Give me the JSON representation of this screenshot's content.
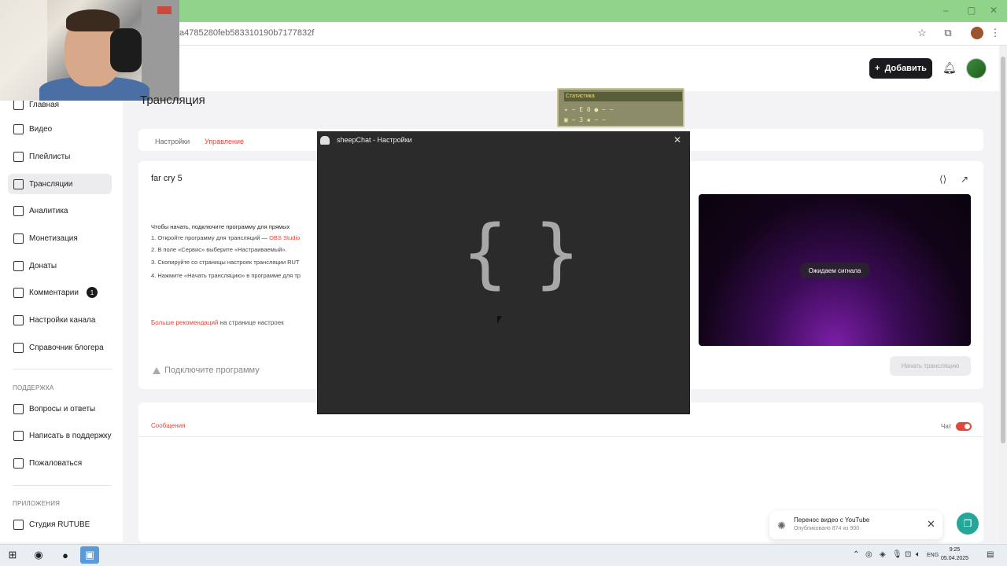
{
  "browser": {
    "url": "a4785280feb583310190b7177832f",
    "window_controls": [
      "–",
      "▢",
      "✕"
    ]
  },
  "header": {
    "add_button_label": "Добавить"
  },
  "sidebar": {
    "items": [
      {
        "label": "Главная",
        "icon": "home-icon"
      },
      {
        "label": "Видео",
        "icon": "video-icon"
      },
      {
        "label": "Плейлисты",
        "icon": "playlist-icon"
      },
      {
        "label": "Трансляции",
        "icon": "broadcast-icon",
        "active": true
      },
      {
        "label": "Аналитика",
        "icon": "analytics-icon"
      },
      {
        "label": "Монетизация",
        "icon": "monetization-icon"
      },
      {
        "label": "Донаты",
        "icon": "donations-icon"
      },
      {
        "label": "Комментарии",
        "icon": "comments-icon",
        "badge": "1"
      },
      {
        "label": "Настройки канала",
        "icon": "settings-icon"
      },
      {
        "label": "Справочник блогера",
        "icon": "handbook-icon"
      }
    ],
    "support_heading": "ПОДДЕРЖКА",
    "support_items": [
      {
        "label": "Вопросы и ответы",
        "icon": "faq-icon"
      },
      {
        "label": "Написать в поддержку",
        "icon": "mail-icon"
      },
      {
        "label": "Пожаловаться",
        "icon": "flag-icon"
      }
    ],
    "apps_heading": "ПРИЛОЖЕНИЯ",
    "apps_items": [
      {
        "label": "Студия RUTUBE",
        "icon": "studio-icon"
      }
    ]
  },
  "main": {
    "page_title": "Трансляция",
    "tabs": [
      {
        "label": "Настройки",
        "active": false
      },
      {
        "label": "Управление",
        "active": true
      }
    ],
    "stream_name": "far cry 5",
    "instructions_head": "Чтобы начать, подключите программу для прямых",
    "instructions": [
      {
        "prefix": "1. Откройте программу для трансляций — ",
        "link": "OBS Studio"
      },
      {
        "prefix": "2. В поле «Сервис» выберите «Настраиваемый».",
        "link": ""
      },
      {
        "prefix": "3. Скопируйте со страницы настроек трансляции RUT",
        "link": ""
      },
      {
        "prefix": "4. Нажмите «Начать трансляцию» в программе для тр",
        "link": ""
      }
    ],
    "more_link": "Больше рекомендаций",
    "more_suffix": " на странице настроек",
    "connect_label": "Подключите программу",
    "preview_status": "Ожидаем сигнала",
    "start_button": "Начать трансляцию",
    "messages_tab": "Сообщения",
    "chat_label": "Чат",
    "chat_enabled": true
  },
  "stats_overlay": {
    "title": "Статистика",
    "row1": "✦ ~ E 0 ● ~ ~",
    "row2": "▣ ~ 3 ▪ ~ ~"
  },
  "modal": {
    "title": "sheepChat - Настройки",
    "glyph": "{ }"
  },
  "toast": {
    "title": "Перенос видео с YouTube",
    "subtitle": "Опубликовано 874 из 900"
  },
  "taskbar": {
    "time": "9:25",
    "date": "05.04.2025",
    "lang": "ENG"
  },
  "colors": {
    "accent": "#e3463a",
    "browser_frame": "#8fd48a",
    "modal_bg": "#2b2b2b"
  }
}
